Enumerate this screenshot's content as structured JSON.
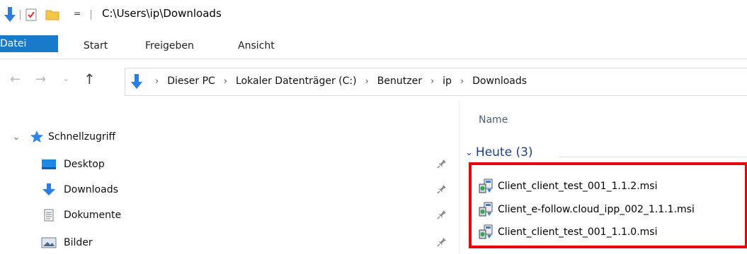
{
  "window": {
    "title_path": "C:\\Users\\ip\\Downloads",
    "quick_access_toolbar": {
      "customize_glyph": "="
    }
  },
  "ribbon": {
    "tabs": [
      "Datei",
      "Start",
      "Freigeben",
      "Ansicht"
    ],
    "file_tab_color": "#1979ca"
  },
  "address_bar": {
    "crumbs": [
      "Dieser PC",
      "Lokaler Datenträger (C:)",
      "Benutzer",
      "ip",
      "Downloads"
    ],
    "separator": "›"
  },
  "nav_pane": {
    "quick_access_label": "Schnellzugriff",
    "items": [
      {
        "label": "Desktop",
        "icon": "desktop-icon"
      },
      {
        "label": "Downloads",
        "icon": "downloads-icon"
      },
      {
        "label": "Dokumente",
        "icon": "documents-icon"
      },
      {
        "label": "Bilder",
        "icon": "pictures-icon"
      }
    ]
  },
  "file_list": {
    "column_header": "Name",
    "group": {
      "title": "Heute (3)"
    },
    "files": [
      {
        "name": "Client_client_test_001_1.1.2.msi",
        "icon": "msi-installer-icon"
      },
      {
        "name": "Client_e-follow.cloud_ipp_002_1.1.1.msi",
        "icon": "msi-installer-icon"
      },
      {
        "name": "Client_client_test_001_1.1.0.msi",
        "icon": "msi-installer-icon"
      }
    ],
    "highlight_color": "#e8000f"
  }
}
